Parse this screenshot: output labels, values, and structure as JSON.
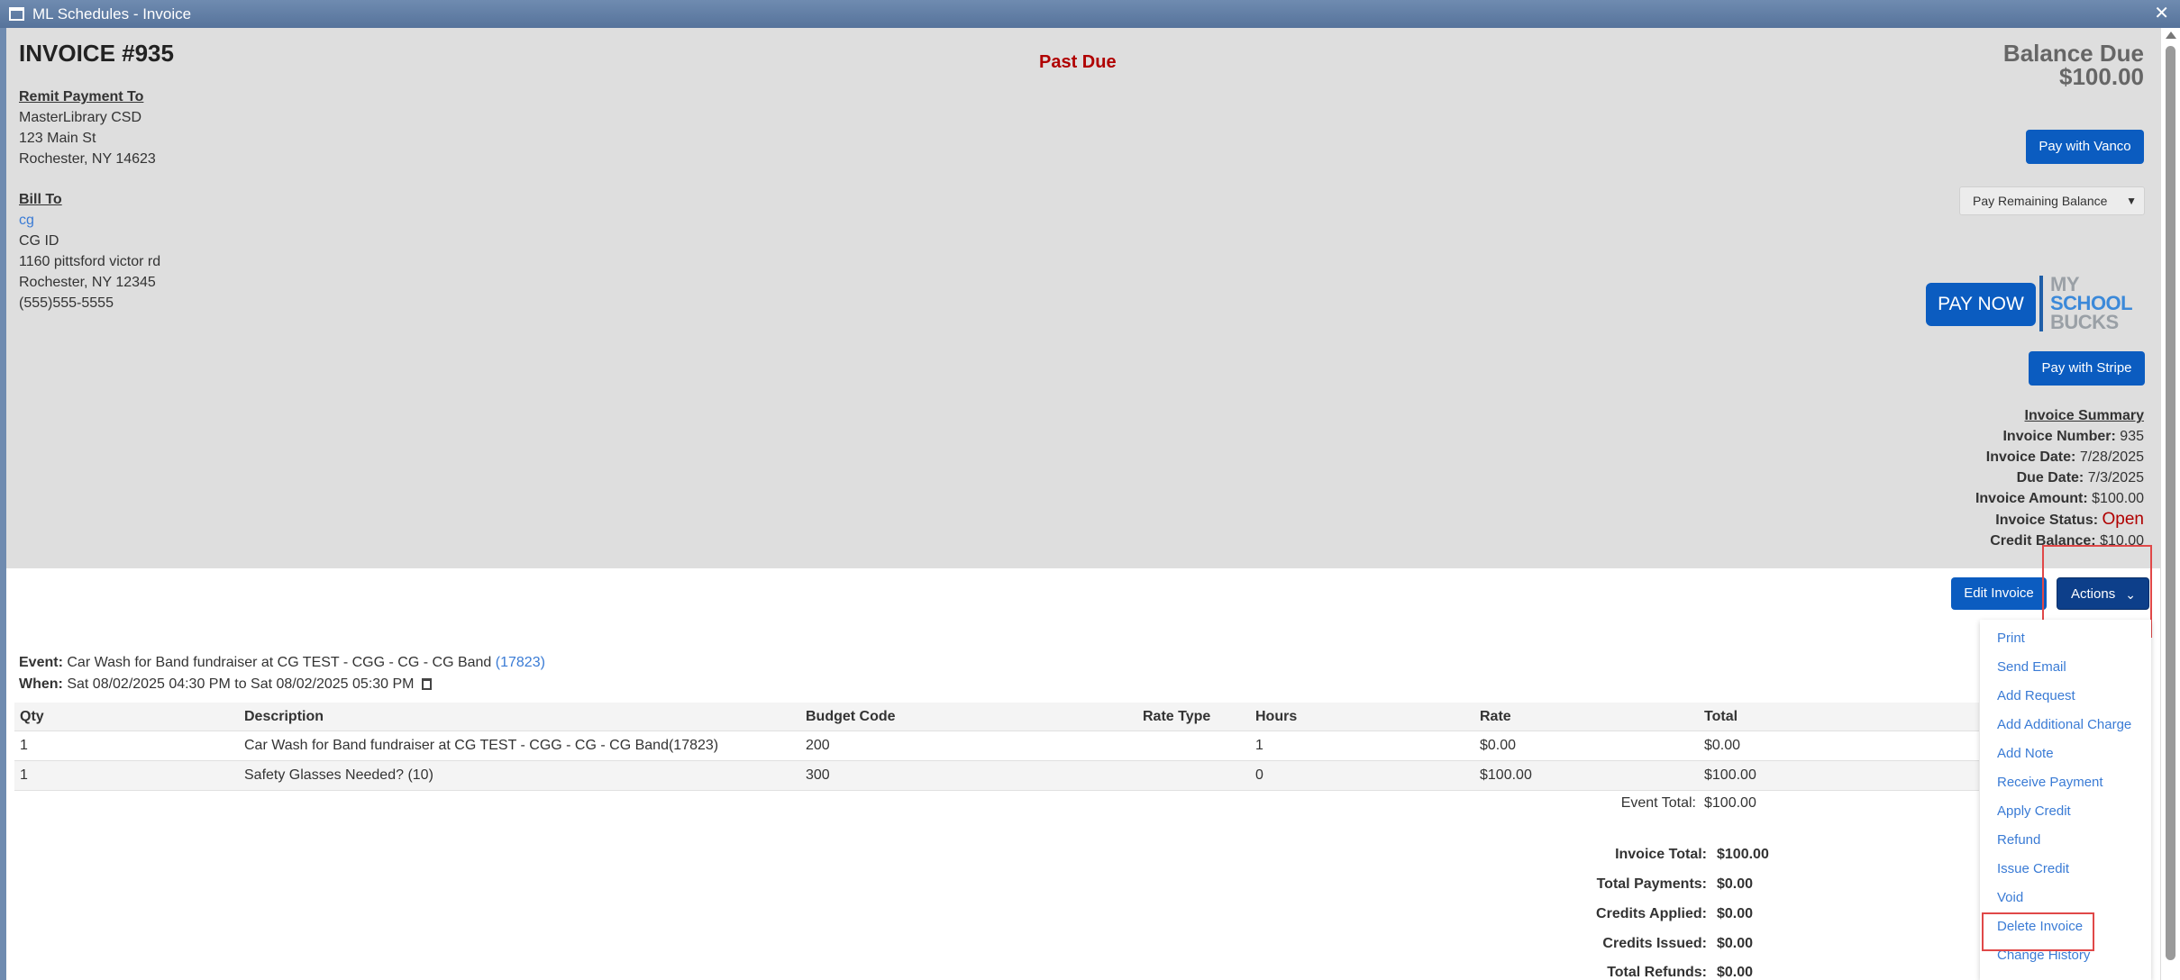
{
  "window": {
    "title": "ML Schedules - Invoice",
    "close_glyph": "✕"
  },
  "invoice": {
    "title": "INVOICE #935",
    "status_banner": "Past Due",
    "balance_due_label": "Balance Due",
    "balance_due_value": "$100.00"
  },
  "remit": {
    "header": "Remit Payment To",
    "lines": [
      "MasterLibrary CSD",
      "123 Main St",
      "Rochester, NY 14623"
    ]
  },
  "bill_to": {
    "header": "Bill To",
    "name_link": "cg",
    "lines": [
      "CG ID",
      "1160 pittsford victor rd",
      "Rochester, NY 12345",
      "(555)555-5555"
    ]
  },
  "payment": {
    "vanco_label": "Pay with Vanco",
    "select_value": "Pay Remaining Balance",
    "pay_now_label": "PAY NOW",
    "logo_lines": [
      "MY",
      "SCHOOL",
      "BUCKS"
    ],
    "stripe_label": "Pay with Stripe"
  },
  "summary": {
    "header": "Invoice Summary",
    "number_label": "Invoice Number:",
    "number_value": "935",
    "date_label": "Invoice Date:",
    "date_value": "7/28/2025",
    "due_label": "Due Date:",
    "due_value": "7/3/2025",
    "amount_label": "Invoice Amount:",
    "amount_value": "$100.00",
    "status_label": "Invoice Status:",
    "status_value": "Open",
    "credit_label": "Credit Balance:",
    "credit_value": "$10.00"
  },
  "toolbar": {
    "edit_label": "Edit Invoice",
    "actions_label": "Actions"
  },
  "actions_menu": [
    "Print",
    "Send Email",
    "Add Request",
    "Add Additional Charge",
    "Add Note",
    "Receive Payment",
    "Apply Credit",
    "Refund",
    "Issue Credit",
    "Void",
    "Delete Invoice",
    "Change History"
  ],
  "event": {
    "event_label": "Event:",
    "event_text": "Car Wash for Band fundraiser at CG TEST - CGG - CG - CG Band",
    "event_id": "(17823)",
    "when_label": "When:",
    "when_text": "Sat 08/02/2025 04:30 PM to Sat 08/02/2025 05:30 PM"
  },
  "table": {
    "headers": [
      "Qty",
      "Description",
      "Budget Code",
      "Rate Type",
      "Hours",
      "Rate",
      "Total"
    ],
    "rows": [
      [
        "1",
        "Car Wash for Band fundraiser at CG TEST - CGG - CG - CG Band(17823)",
        "200",
        "",
        "1",
        "$0.00",
        "$0.00"
      ],
      [
        "1",
        "Safety Glasses Needed? (10)",
        "300",
        "",
        "0",
        "$100.00",
        "$100.00"
      ]
    ],
    "event_total_label": "Event Total:",
    "event_total_value": "$100.00"
  },
  "totals": [
    {
      "label": "Invoice Total:",
      "value": "$100.00"
    },
    {
      "label": "Total Payments:",
      "value": "$0.00"
    },
    {
      "label": "Credits Applied:",
      "value": "$0.00"
    },
    {
      "label": "Credits Issued:",
      "value": "$0.00"
    },
    {
      "label": "Total Refunds:",
      "value": "$0.00"
    }
  ]
}
